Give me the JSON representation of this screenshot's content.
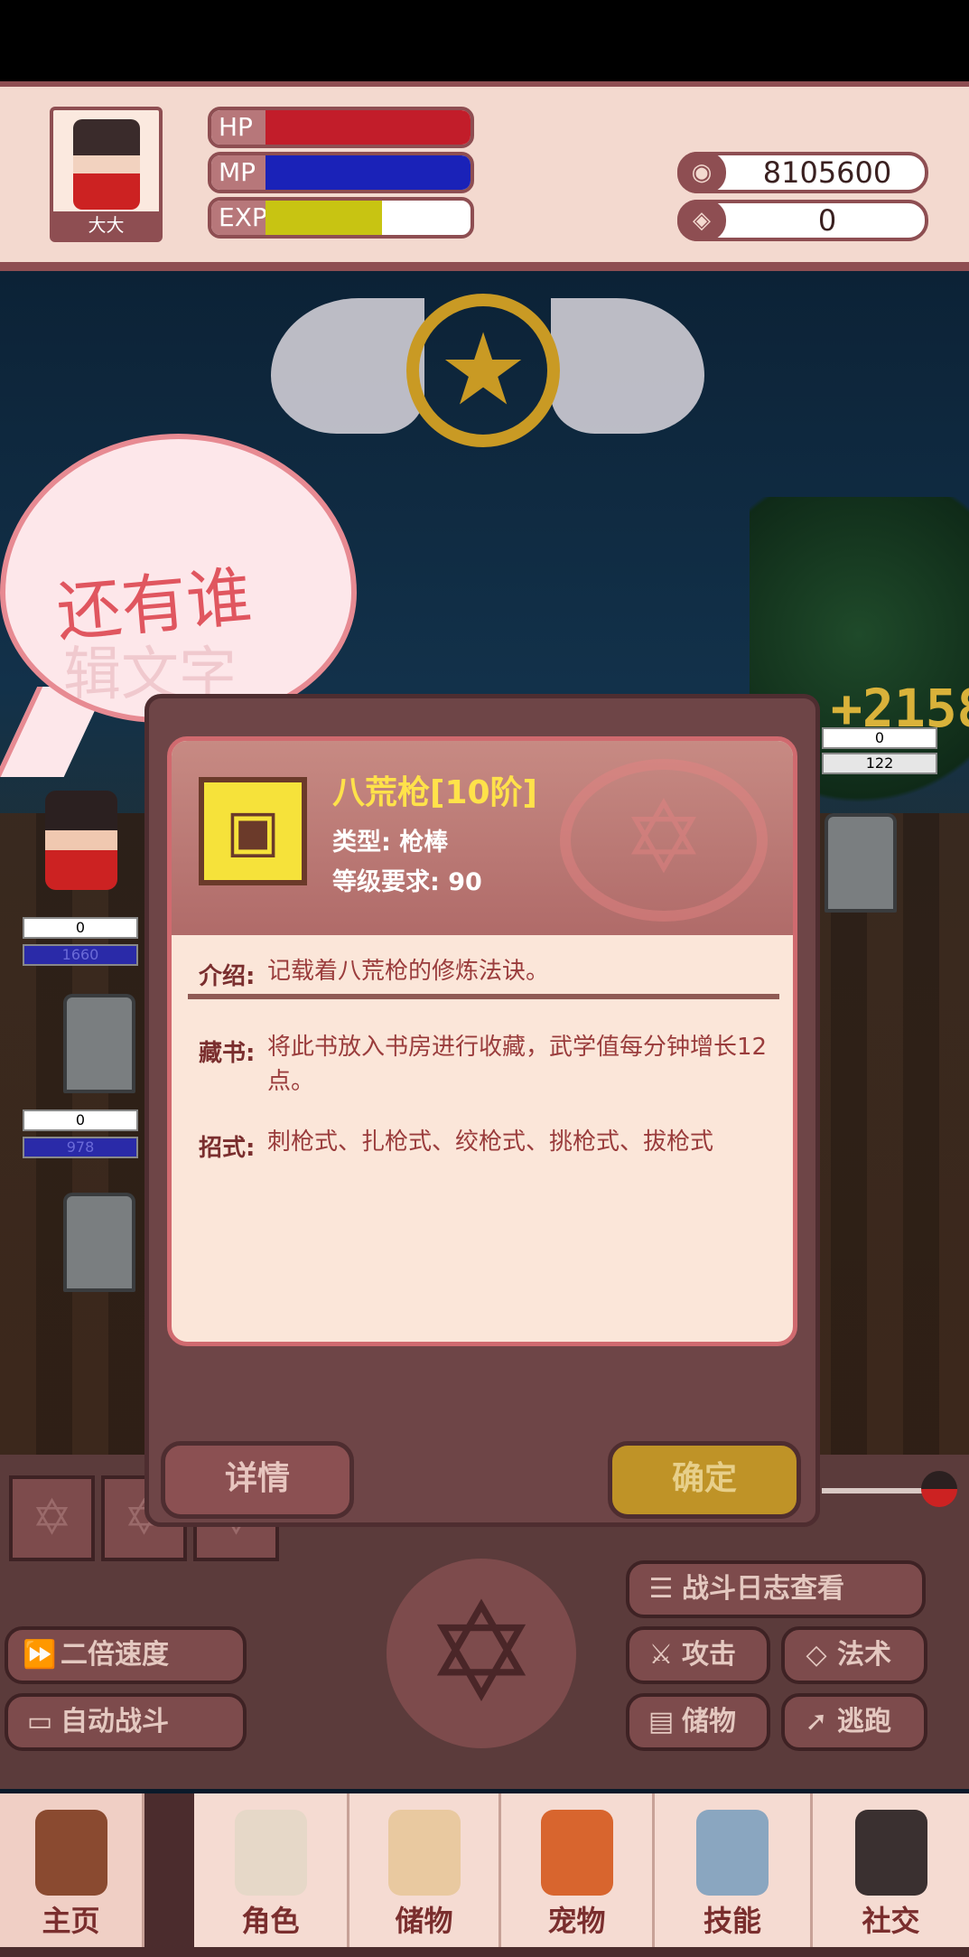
{
  "status": {
    "player_name": "大大",
    "hp_label": "HP",
    "mp_label": "MP",
    "exp_label": "EXP",
    "hp_fill": 1.0,
    "mp_fill": 1.0,
    "exp_fill": 0.57,
    "gold_value": "8105600",
    "gem_value": "0",
    "gold_icon": "coin-icon",
    "gem_icon": "gem-icon"
  },
  "battle": {
    "damage_number": "+2158",
    "enemy_top_bar_1": "0",
    "enemy_top_bar_2": "122",
    "ally_bar_1": "0",
    "ally_bar_2": "1660",
    "ally_bar_3": "0",
    "ally_bar_4": "978"
  },
  "speech_bubble": {
    "text": "还有谁",
    "ghost_text": "辑文字"
  },
  "item": {
    "name": "八荒枪[10阶]",
    "type_line": "类型: 枪棒",
    "level_line": "等级要求: 90",
    "intro_label": "介绍:",
    "intro_text": "记载着八荒枪的修炼法诀。",
    "collect_label": "藏书:",
    "collect_text": "将此书放入书房进行收藏，武学值每分钟增长12点。",
    "moves_label": "招式:",
    "moves_text": "刺枪式、扎枪式、绞枪式、挑枪式、拔枪式"
  },
  "dialog_buttons": {
    "details": "详情",
    "confirm": "确定"
  },
  "controls": {
    "battle_log": "战斗日志查看",
    "double_speed": "二倍速度",
    "auto_battle": "自动战斗",
    "attack": "攻击",
    "magic": "法术",
    "storage": "储物",
    "escape": "逃跑"
  },
  "nav": {
    "home": "主页",
    "role": "角色",
    "storage": "储物",
    "pet": "宠物",
    "skill": "技能",
    "social": "社交"
  },
  "colors": {
    "hp": "#c21d2a",
    "mp": "#1a22b8",
    "exp": "#c8c412",
    "accent": "#8e4e52",
    "item_name": "#ffe24a"
  }
}
